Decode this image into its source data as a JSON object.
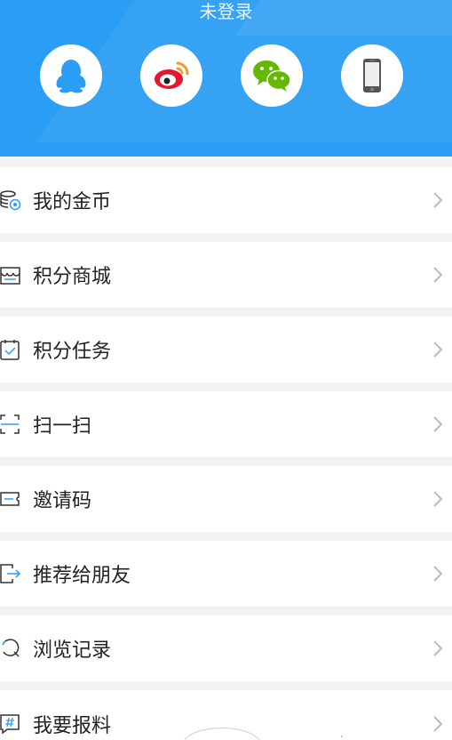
{
  "header": {
    "title": "未登录",
    "accent_color": "#2a9df4",
    "login_options": [
      {
        "name": "qq",
        "icon": "qq-penguin-icon",
        "color": "#2a9df4"
      },
      {
        "name": "weibo",
        "icon": "weibo-icon",
        "color": "#e6162d"
      },
      {
        "name": "wechat",
        "icon": "wechat-icon",
        "color": "#62b900"
      },
      {
        "name": "phone",
        "icon": "phone-icon",
        "color": "#555555"
      }
    ]
  },
  "menu": {
    "items": [
      {
        "label": "我的金币",
        "icon": "coins-icon"
      },
      {
        "label": "积分商城",
        "icon": "store-icon"
      },
      {
        "label": "积分任务",
        "icon": "task-calendar-icon"
      },
      {
        "label": "扫一扫",
        "icon": "scan-icon"
      },
      {
        "label": "邀请码",
        "icon": "ticket-icon"
      },
      {
        "label": "推荐给朋友",
        "icon": "share-icon"
      },
      {
        "label": "浏览记录",
        "icon": "history-icon"
      },
      {
        "label": "我要报料",
        "icon": "hashtag-icon"
      }
    ]
  }
}
